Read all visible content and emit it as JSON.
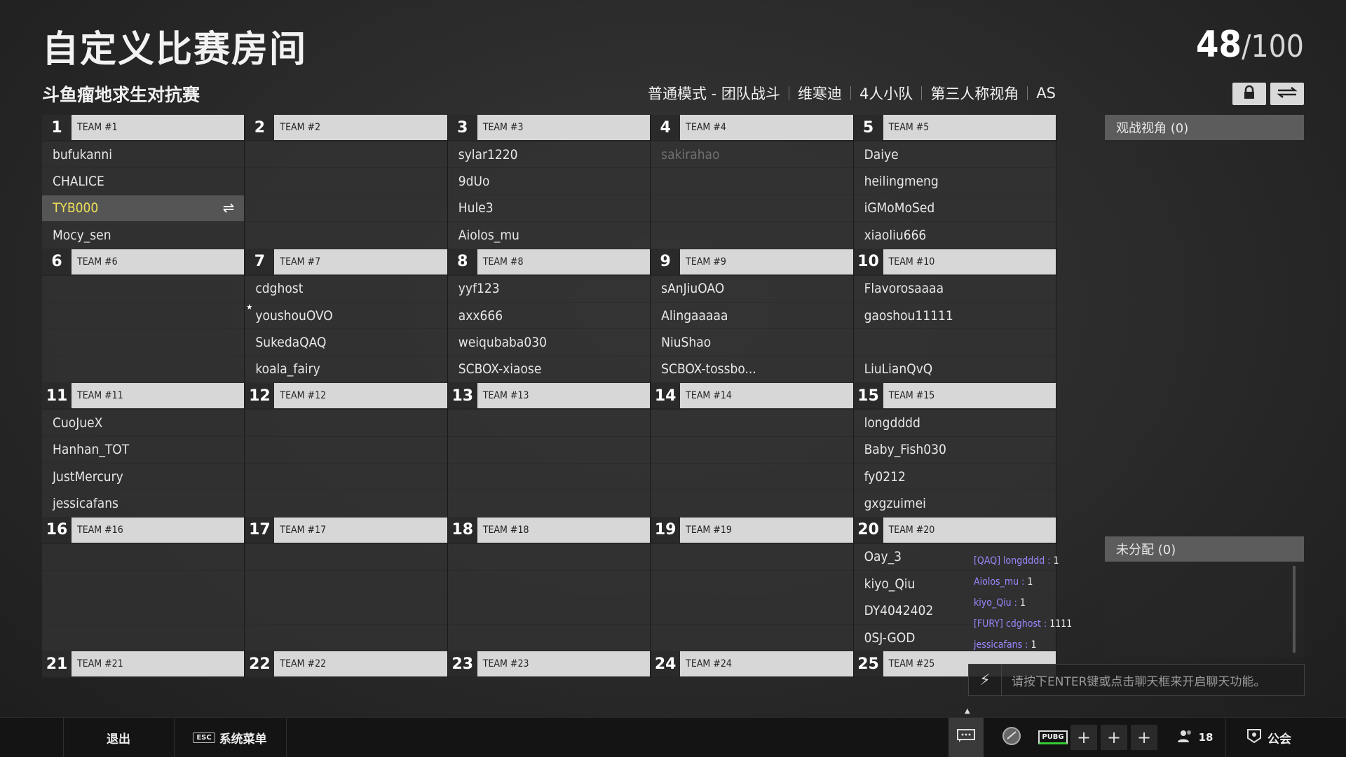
{
  "title": "自定义比赛房间",
  "player_count": {
    "current": "48",
    "max": "/100"
  },
  "subtitle": "斗鱼瘤地求生对抗赛",
  "modes": [
    "普通模式 - 团队战斗",
    "维寒迪",
    "4人小队",
    "第三人称视角",
    "AS"
  ],
  "teams": [
    {
      "num": "1",
      "name": "TEAM #1",
      "players": [
        "bufukanni",
        "CHALICE",
        "TYB000",
        "Mocy_sen"
      ]
    },
    {
      "num": "2",
      "name": "TEAM #2",
      "players": [
        "",
        "",
        "",
        ""
      ]
    },
    {
      "num": "3",
      "name": "TEAM #3",
      "players": [
        "sylar1220",
        "9dUo",
        "Hule3",
        "Aiolos_mu"
      ]
    },
    {
      "num": "4",
      "name": "TEAM #4",
      "players": [
        "sakirahao",
        "",
        "",
        ""
      ]
    },
    {
      "num": "5",
      "name": "TEAM #5",
      "players": [
        "Daiye",
        "heilingmeng",
        "iGMoMoSed",
        "xiaoliu666"
      ]
    },
    {
      "num": "6",
      "name": "TEAM #6",
      "players": [
        "",
        "",
        "",
        ""
      ]
    },
    {
      "num": "7",
      "name": "TEAM #7",
      "players": [
        "cdghost",
        "youshouOVO",
        "SukedaQAQ",
        "koala_fairy"
      ]
    },
    {
      "num": "8",
      "name": "TEAM #8",
      "players": [
        "yyf123",
        "axx666",
        "weiqubaba030",
        "SCBOX-xiaose"
      ]
    },
    {
      "num": "9",
      "name": "TEAM #9",
      "players": [
        "sAnJiuOAO",
        "Alingaaaaa",
        "NiuShao",
        "SCBOX-tossbo..."
      ]
    },
    {
      "num": "10",
      "name": "TEAM #10",
      "players": [
        "Flavorosaaaa",
        "gaoshou11111",
        "",
        "LiuLianQvQ"
      ]
    },
    {
      "num": "11",
      "name": "TEAM #11",
      "players": [
        "CuoJueX",
        "Hanhan_TOT",
        "JustMercury",
        "jessicafans"
      ]
    },
    {
      "num": "12",
      "name": "TEAM #12",
      "players": [
        "",
        "",
        "",
        ""
      ]
    },
    {
      "num": "13",
      "name": "TEAM #13",
      "players": [
        "",
        "",
        "",
        ""
      ]
    },
    {
      "num": "14",
      "name": "TEAM #14",
      "players": [
        "",
        "",
        "",
        ""
      ]
    },
    {
      "num": "15",
      "name": "TEAM #15",
      "players": [
        "longdddd",
        "Baby_Fish030",
        "fy0212",
        "gxgzuimei"
      ]
    },
    {
      "num": "16",
      "name": "TEAM #16",
      "players": [
        "",
        "",
        "",
        ""
      ]
    },
    {
      "num": "17",
      "name": "TEAM #17",
      "players": [
        "",
        "",
        "",
        ""
      ]
    },
    {
      "num": "18",
      "name": "TEAM #18",
      "players": [
        "",
        "",
        "",
        ""
      ]
    },
    {
      "num": "19",
      "name": "TEAM #19",
      "players": [
        "",
        "",
        "",
        ""
      ]
    },
    {
      "num": "20",
      "name": "TEAM #20",
      "players": [
        "Oay_3",
        "kiyo_Qiu",
        "DY4042402",
        "0SJ-GOD"
      ]
    },
    {
      "num": "21",
      "name": "TEAM #21",
      "players": []
    },
    {
      "num": "22",
      "name": "TEAM #22",
      "players": []
    },
    {
      "num": "23",
      "name": "TEAM #23",
      "players": []
    },
    {
      "num": "24",
      "name": "TEAM #24",
      "players": []
    },
    {
      "num": "25",
      "name": "TEAM #25",
      "players": []
    }
  ],
  "spectator_header": "观战视角 (0)",
  "unassigned_header": "未分配 (0)",
  "chat": [
    {
      "user": "[QAQ] longdddd :",
      "text": "1"
    },
    {
      "user": "Aiolos_mu :",
      "text": "1"
    },
    {
      "user": "kiyo_Qiu :",
      "text": "1"
    },
    {
      "user": "[FURY] cdghost :",
      "text": "1111"
    },
    {
      "user": "jessicafans :",
      "text": "1"
    }
  ],
  "chat_placeholder": "请按下ENTER键或点击聊天框来开启聊天功能。",
  "bottom": {
    "exit": "退出",
    "esc_key": "ESC",
    "menu": "系统菜单",
    "pubg_badge": "PUBG",
    "friends": "18",
    "guild": "公会"
  },
  "colors": {
    "highlight": "#f1e05a",
    "chat_user": "#9a88ff"
  }
}
